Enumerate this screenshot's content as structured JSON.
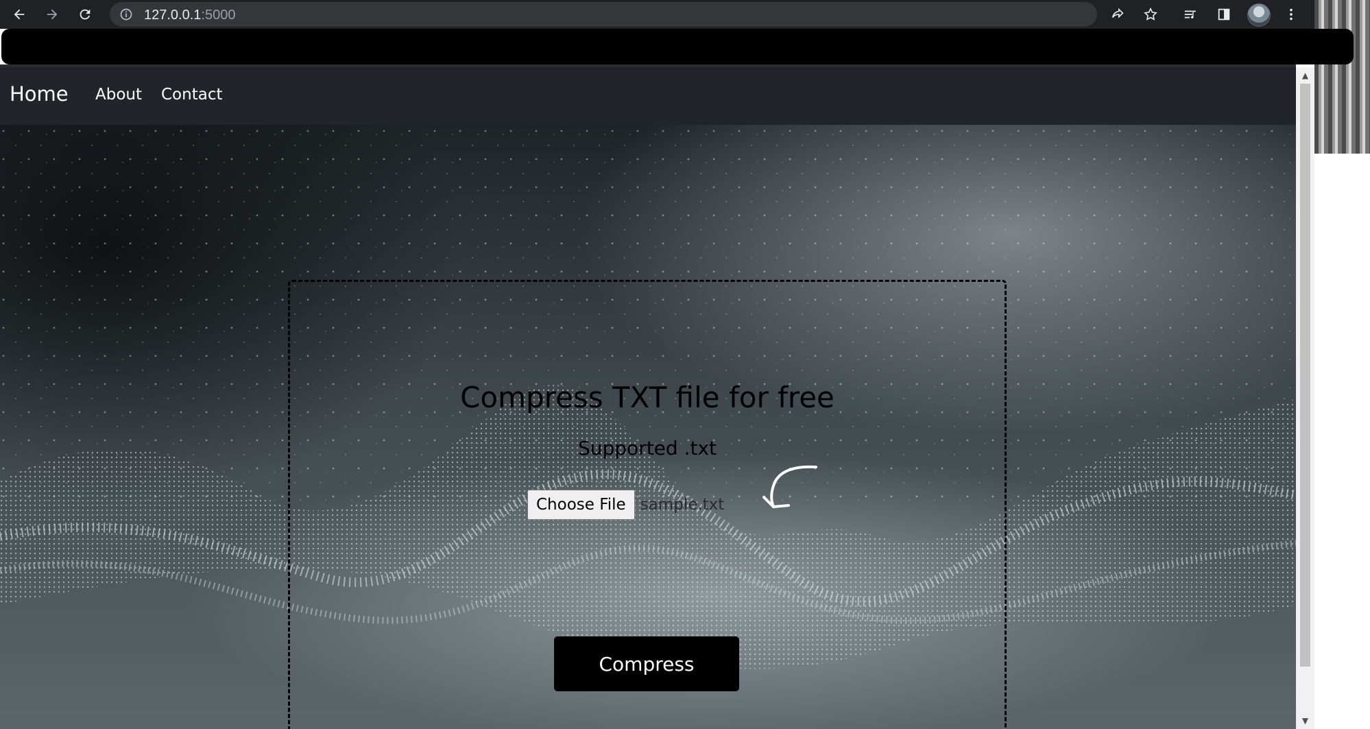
{
  "browser": {
    "url_host": "127.0.0.1",
    "url_port": ":5000"
  },
  "nav": {
    "brand": "Home",
    "links": [
      "About",
      "Contact"
    ]
  },
  "hero": {
    "title": "Compress TXT file for free",
    "subtitle": "Supported .txt",
    "choose_file_label": "Choose File",
    "selected_file": "sample.txt",
    "compress_label": "Compress"
  },
  "icons": {
    "back": "back-arrow-icon",
    "forward": "forward-arrow-icon",
    "reload": "reload-icon",
    "site_info": "info-icon",
    "share": "share-icon",
    "bookmark": "star-icon",
    "reading_list": "reading-list-icon",
    "side_panel": "side-panel-icon",
    "menu": "kebab-menu-icon",
    "hand_arrow": "hand-drawn-arrow-icon"
  },
  "colors": {
    "navbar": "#212529",
    "button": "#000000",
    "chrome": "#202124"
  }
}
